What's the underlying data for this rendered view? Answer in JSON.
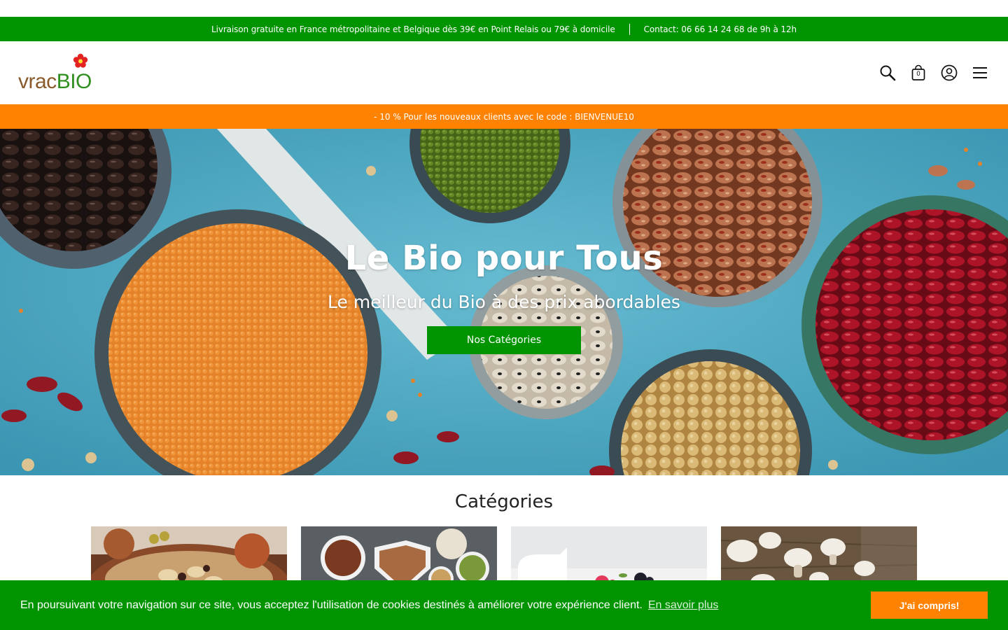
{
  "announcement": {
    "shipping": "Livraison gratuite en France métropolitaine et Belgique dès 39€ en Point Relais ou 79€ à domicile",
    "contact": "Contact: 06 66 14 24 68 de 9h à 12h"
  },
  "header": {
    "logo_part1": "vrac",
    "logo_part2": "BIO",
    "cart_count": "0",
    "icons": [
      "search-icon",
      "cart-icon",
      "account-icon",
      "menu-icon"
    ]
  },
  "promo": {
    "text": "- 10 % Pour les nouveaux clients avec le code : BIENVENUE10"
  },
  "hero": {
    "title": "Le Bio pour Tous",
    "subtitle": "Le meilleur du Bio à des prix abordables",
    "button_label": "Nos Catégories"
  },
  "categories": {
    "title": "Catégories"
  },
  "cookie": {
    "message": "En poursuivant votre navigation sur ce site, vous acceptez l'utilisation de cookies destinés à améliorer votre expérience client.",
    "learn_more": "En savoir plus",
    "accept": "J'ai compris!"
  },
  "colors": {
    "green": "#009400",
    "orange": "#ff8200",
    "hero_blue": "#57b4cd"
  }
}
